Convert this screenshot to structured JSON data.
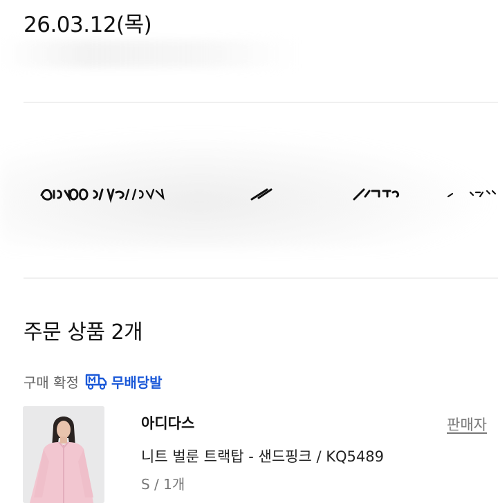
{
  "order": {
    "date": "26.03.12(목)"
  },
  "section": {
    "title": "주문 상품 2개"
  },
  "status": {
    "label": "구매 확정",
    "shipping_badge": "무배당발",
    "badge_icon": "delivery-truck-icon",
    "badge_color": "#1a58d8"
  },
  "product": {
    "brand": "아디다스",
    "name": "니트 벌룬 트랙탑 - 샌드핑크 / KQ5489",
    "option": "S / 1개",
    "seller_link": "판매자",
    "image_icon": "product-photo"
  },
  "colors": {
    "text_primary": "#111111",
    "text_secondary": "#777777",
    "divider": "#f0f0f0",
    "accent": "#1a58d8",
    "product_bg": "#e9e9ea",
    "garment": "#f2c6d0"
  }
}
